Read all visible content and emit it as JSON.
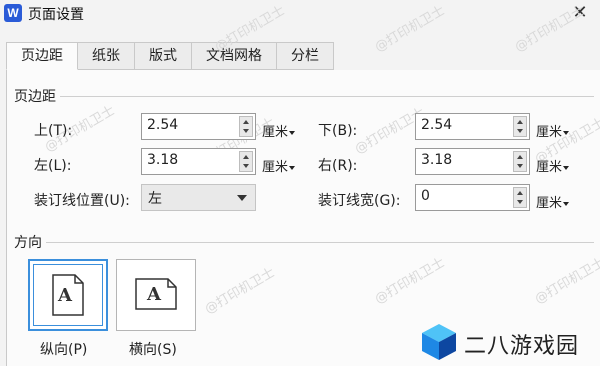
{
  "window": {
    "app_logo": "W",
    "title": "页面设置",
    "close": "✕"
  },
  "tabs": [
    "页边距",
    "纸张",
    "版式",
    "文档网格",
    "分栏"
  ],
  "margins": {
    "section_title": "页边距",
    "top_label": "上(T):",
    "top_value": "2.54",
    "bottom_label": "下(B):",
    "bottom_value": "2.54",
    "left_label": "左(L):",
    "left_value": "3.18",
    "right_label": "右(R):",
    "right_value": "3.18",
    "gutter_pos_label": "装订线位置(U):",
    "gutter_pos_value": "左",
    "gutter_width_label": "装订线宽(G):",
    "gutter_width_value": "0",
    "unit": "厘米"
  },
  "orientation": {
    "section_title": "方向",
    "portrait_label": "纵向(P)",
    "landscape_label": "横向(S)",
    "icon_letter": "A",
    "selected": "portrait"
  },
  "watermark": "@打印机卫士",
  "brand": {
    "text": "二八游戏园"
  },
  "colors": {
    "accent": "#3b8fdc",
    "app_logo": "#2a5bd7"
  }
}
